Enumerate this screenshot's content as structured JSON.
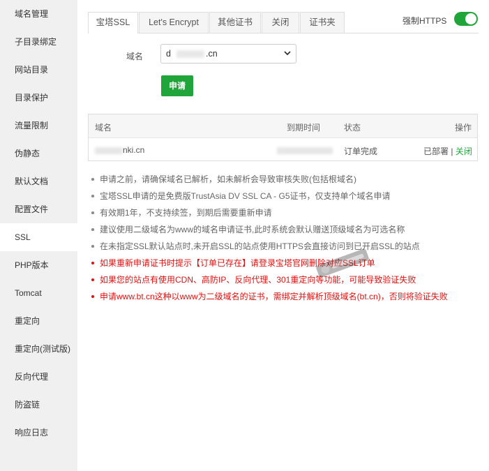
{
  "sidebar": {
    "items": [
      {
        "label": "域名管理"
      },
      {
        "label": "子目录绑定"
      },
      {
        "label": "网站目录"
      },
      {
        "label": "目录保护"
      },
      {
        "label": "流量限制"
      },
      {
        "label": "伪静态"
      },
      {
        "label": "默认文档"
      },
      {
        "label": "配置文件"
      },
      {
        "label": "SSL"
      },
      {
        "label": "PHP版本"
      },
      {
        "label": "Tomcat"
      },
      {
        "label": "重定向"
      },
      {
        "label": "重定向(测试版)"
      },
      {
        "label": "反向代理"
      },
      {
        "label": "防盗链"
      },
      {
        "label": "响应日志"
      }
    ],
    "active_index": 8
  },
  "tabs": [
    {
      "label": "宝塔SSL"
    },
    {
      "label": "Let's Encrypt"
    },
    {
      "label": "其他证书"
    },
    {
      "label": "关闭"
    },
    {
      "label": "证书夹"
    }
  ],
  "force_https": {
    "label": "强制HTTPS",
    "enabled": true
  },
  "form": {
    "domain_label": "域名",
    "domain_value_start": "d",
    "domain_value_end": ".cn",
    "apply_label": "申请"
  },
  "table": {
    "headers": {
      "domain": "域名",
      "expire": "到期时间",
      "status": "状态",
      "action": "操作"
    },
    "row": {
      "domain": "nki.cn",
      "expire": "",
      "status": "订单完成",
      "deployed": "已部署",
      "separator": "|",
      "close": "关闭"
    }
  },
  "notes": [
    {
      "text": "申请之前，请确保域名已解析，如未解析会导致审核失败(包括根域名)",
      "color": "gray"
    },
    {
      "text": "宝塔SSL申请的是免费版TrustAsia DV SSL CA - G5证书，仅支持单个域名申请",
      "color": "gray"
    },
    {
      "text": "有效期1年，不支持续签，到期后需要重新申请",
      "color": "gray"
    },
    {
      "text": "建议使用二级域名为www的域名申请证书,此时系统会默认赠送顶级域名为可选名称",
      "color": "gray"
    },
    {
      "text": "在未指定SSL默认站点时,未开启SSL的站点使用HTTPS会直接访问到已开启SSL的站点",
      "color": "gray"
    },
    {
      "text": "如果重新申请证书时提示【订单已存在】请登录宝塔官网删除对应SSL订单",
      "color": "red"
    },
    {
      "text": "如果您的站点有使用CDN、高防IP、反向代理、301重定向等功能，可能导致验证失败",
      "color": "red"
    },
    {
      "text": "申请www.bt.cn这种以www为二级域名的证书，需绑定并解析顶级域名(bt.cn)，否则将验证失败",
      "color": "red"
    }
  ],
  "colors": {
    "accent": "#20a53a",
    "warning": "#e01010",
    "sidebar_bg": "#f0f0f0"
  }
}
